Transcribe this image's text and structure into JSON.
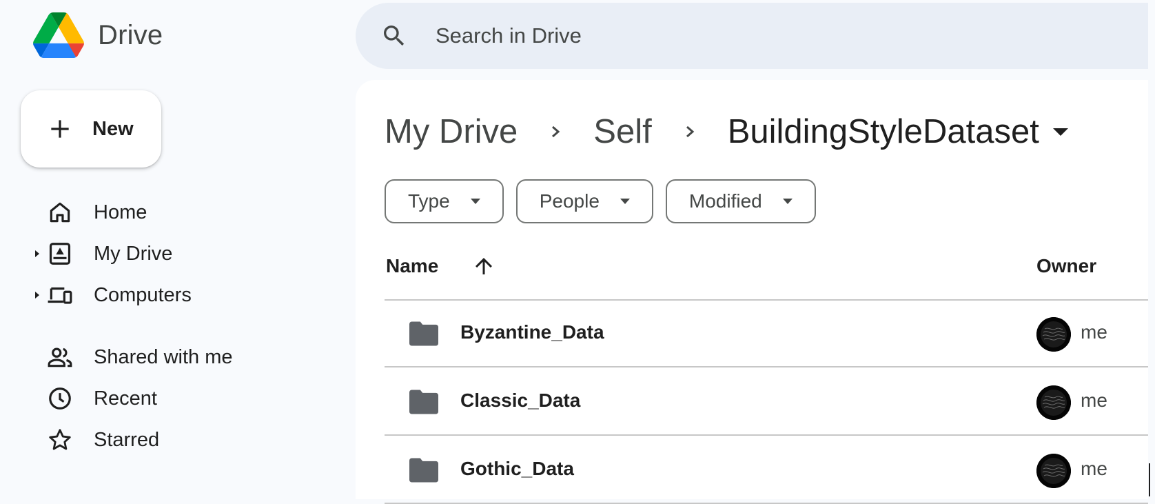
{
  "app": {
    "name": "Drive"
  },
  "search": {
    "placeholder": "Search in Drive"
  },
  "new_button": {
    "label": "New"
  },
  "sidebar": {
    "items": [
      {
        "label": "Home",
        "icon": "home-icon"
      },
      {
        "label": "My Drive",
        "icon": "my-drive-icon",
        "expandable": true
      },
      {
        "label": "Computers",
        "icon": "computers-icon",
        "expandable": true
      },
      {
        "label": "Shared with me",
        "icon": "shared-with-me-icon"
      },
      {
        "label": "Recent",
        "icon": "clock-icon"
      },
      {
        "label": "Starred",
        "icon": "star-icon"
      }
    ]
  },
  "breadcrumb": {
    "items": [
      "My Drive",
      "Self",
      "BuildingStyleDataset"
    ]
  },
  "filters": {
    "chips": [
      "Type",
      "People",
      "Modified"
    ]
  },
  "list": {
    "columns": {
      "name": "Name",
      "owner": "Owner"
    },
    "sort": "ascending",
    "rows": [
      {
        "name": "Byzantine_Data",
        "owner": "me",
        "type": "folder"
      },
      {
        "name": "Classic_Data",
        "owner": "me",
        "type": "folder"
      },
      {
        "name": "Gothic_Data",
        "owner": "me",
        "type": "folder"
      }
    ]
  },
  "colors": {
    "background": "#f8fafd",
    "search_bg": "#e9eef6",
    "panel": "#ffffff",
    "text_primary": "#1f1f1f",
    "text_secondary": "#444746",
    "folder": "#5f6368",
    "divider": "#c7c7c7"
  }
}
